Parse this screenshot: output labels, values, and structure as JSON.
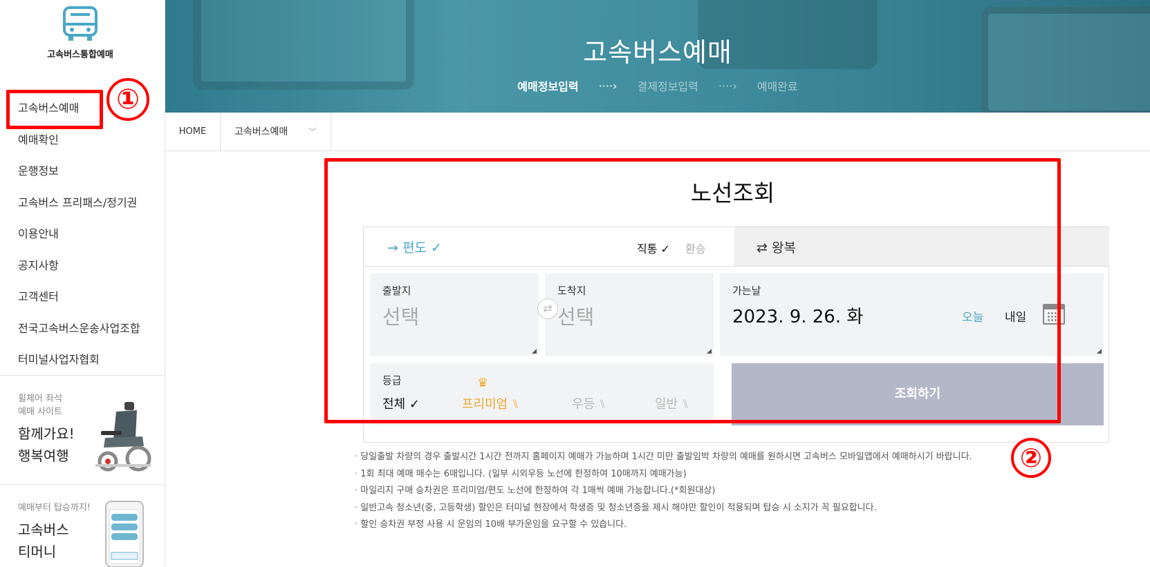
{
  "sidebar": {
    "logo_text": "고속버스통합예매",
    "items": [
      {
        "label": "고속버스예매"
      },
      {
        "label": "예매확인"
      },
      {
        "label": "운행정보"
      },
      {
        "label": "고속버스 프리패스/정기권"
      },
      {
        "label": "이용안내"
      },
      {
        "label": "공지사항"
      },
      {
        "label": "고객센터"
      },
      {
        "label": "전국고속버스운송사업조합"
      },
      {
        "label": "터미널사업자협회"
      }
    ],
    "promo1": {
      "small1": "휠체어 좌석",
      "small2": "예매 사이트",
      "big1": "함께가요!",
      "big2": "행복여행"
    },
    "promo2": {
      "small": "예매부터 탑승까지!",
      "big1": "고속버스",
      "big2": "티머니"
    }
  },
  "annotations": {
    "one": "①",
    "two": "②",
    "accent": "#ff0000"
  },
  "hero": {
    "title": "고속버스예매",
    "steps": [
      "예매정보입력",
      "결제정보입력",
      "예매완료"
    ],
    "arrow": "····›"
  },
  "breadcrumb": {
    "home": "HOME",
    "current": "고속버스예매",
    "chevron": "﹀"
  },
  "search": {
    "title": "노선조회",
    "tab_oneway": "→ 편도 ✓",
    "opt_direct": "직통 ✓",
    "opt_transfer": "환승",
    "tab_round": "⇄ 왕복",
    "departure_label": "출발지",
    "departure_value": "선택",
    "arrival_label": "도착지",
    "arrival_value": "선택",
    "swap_icon": "⇄",
    "date_label": "가는날",
    "date_value": "2023. 9. 26. 화",
    "today": "오늘",
    "tomorrow": "내일",
    "grade_label": "등급",
    "grades": [
      "전체 ✓",
      "프리미엄",
      "우등",
      "일반"
    ],
    "crown": "♛",
    "seat_icon": "⑊",
    "submit": "조회하기",
    "accent_color": "#4aa7c6",
    "premium_color": "#f0a830"
  },
  "notes": [
    "당일출발 차량의 경우 출발시간 1시간 전까지 홈페이지 예매가 가능하며 1시간 미만 출발임박 차량의 예매를 원하시면 고속버스 모바일앱에서 예매하시기 바랍니다.",
    "1회 최대 예매 매수는 6매입니다. (일부 시외우등 노선에 한정하여 10매까지 예매가능)",
    "마일리지 구매 승차권은 프리미엄/편도 노선에 한정하여 각 1매씩 예매 가능합니다.(*회원대상)",
    "일반고속 청소년(중, 고등학생) 할인은 터미널 현장에서 학생증 및 청소년증을 제시 해야만 할인이 적용되며 탑승 시 소지가 꼭 필요합니다.",
    "할인 승차권 부정 사용 시 운임의 10배 부가운임을 요구할 수 있습니다."
  ]
}
